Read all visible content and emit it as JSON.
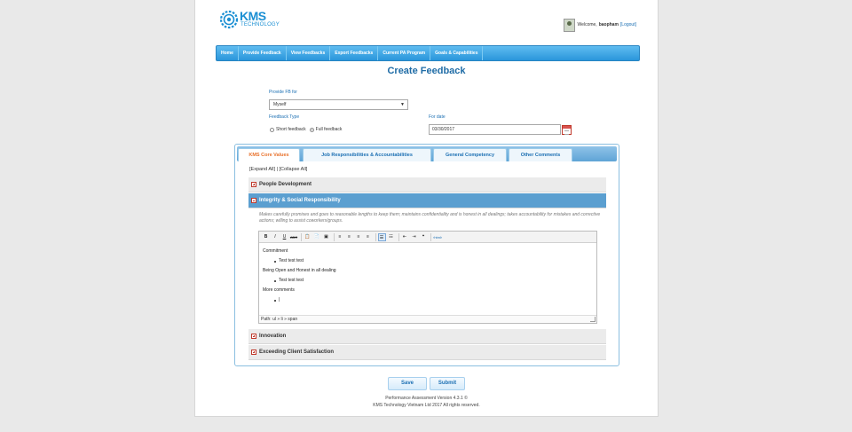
{
  "brand": {
    "name": "KMS",
    "tagline": "TECHNOLOGY",
    "color": "#1b8fd3"
  },
  "user": {
    "welcome": "Welcome,",
    "username": "baopham",
    "logout": "[Logout]"
  },
  "nav": [
    "Home",
    "Provide Feedback",
    "View Feedbacks",
    "Export Feedbacks",
    "Current PA Program",
    "Goals & Capabilities"
  ],
  "page_title": "Create Feedback",
  "form": {
    "provide_for_label": "Provide FB for",
    "provide_for_value": "Myself",
    "feedback_type_label": "Feedback Type",
    "type_short": "Short feedback",
    "type_full": "Full feedback",
    "selected_type": "Full feedback",
    "date_label": "For date",
    "date_value": "03/30/2017"
  },
  "tabs": [
    "KMS Core Values",
    "Job Responsibilities & Accountabilities",
    "General Competency",
    "Other Comments"
  ],
  "active_tab": "KMS Core Values",
  "expand_collapse": "[Expand All] | [Collapse All]",
  "sections": [
    {
      "title": "People Development",
      "open": false
    },
    {
      "title": "Integrity & Social Responsibility",
      "open": true
    },
    {
      "title": "Innovation",
      "open": false
    },
    {
      "title": "Exceeding Client Satisfaction",
      "open": false
    }
  ],
  "integrity_description": "Makes carefully promises and goes to reasonable lengths to keep them; maintains confidentiality and is honest in all dealings; takes accountability for mistakes and corrective actions; willing to assist coworkers/groups.",
  "editor": {
    "toolbar": [
      "B",
      "I",
      "U",
      "ABC",
      "paste-text",
      "paste-word",
      "select-all",
      "align-left",
      "align-center",
      "align-right",
      "justify",
      "bullet-list",
      "numbered-list",
      "outdent",
      "indent",
      "blockquote",
      "html"
    ],
    "lines": [
      {
        "type": "p",
        "text": "Commitment"
      },
      {
        "type": "li",
        "text": "Test test test"
      },
      {
        "type": "p",
        "text": "Being Open and Honest in all dealing"
      },
      {
        "type": "li",
        "text": "Test test test"
      },
      {
        "type": "p",
        "text": "More comments"
      },
      {
        "type": "li",
        "text": "|"
      }
    ],
    "path": "Path: ul » li » span"
  },
  "buttons": {
    "save": "Save",
    "submit": "Submit"
  },
  "footer": {
    "line1": "Performance Assessment Version 4.3.1 ©",
    "line2": "KMS Technology Vietnam Ltd 2017 All rights reserved."
  }
}
